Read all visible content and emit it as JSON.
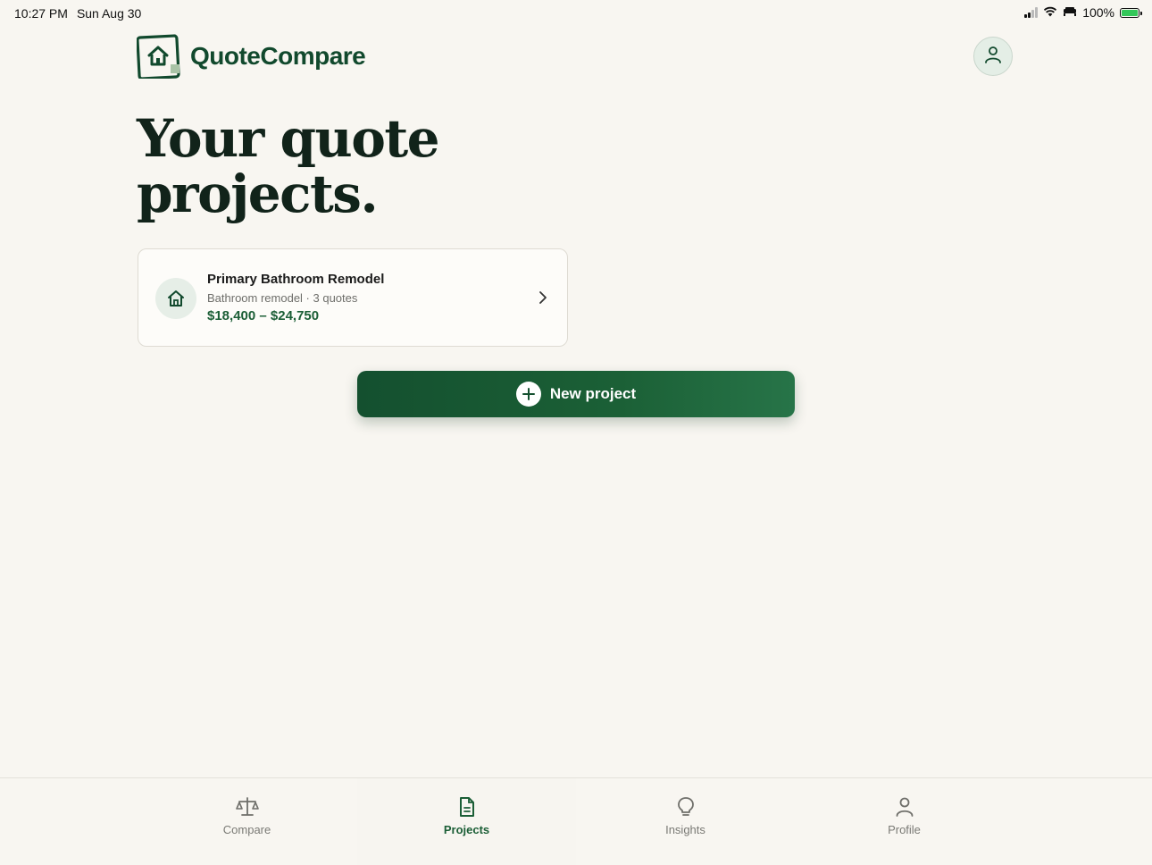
{
  "status_bar": {
    "time": "10:27 PM",
    "date": "Sun Aug 30",
    "battery": "100%"
  },
  "header": {
    "brand": "QuoteCompare",
    "account_icon": "user-icon"
  },
  "page": {
    "title": "Your quote projects."
  },
  "projects": [
    {
      "name": "Primary Bathroom Remodel",
      "meta": "Bathroom remodel · 3 quotes",
      "range": "$18,400 – $24,750",
      "icon": "house-icon"
    }
  ],
  "actions": {
    "new_project_label": "New project"
  },
  "tabs": [
    {
      "label": "Compare",
      "icon": "scale-icon",
      "active": false
    },
    {
      "label": "Projects",
      "icon": "document-icon",
      "active": true
    },
    {
      "label": "Insights",
      "icon": "lightbulb-icon",
      "active": false
    },
    {
      "label": "Profile",
      "icon": "person-icon",
      "active": false
    }
  ],
  "colors": {
    "brand_green": "#11492d",
    "accent_green": "#1b5e36",
    "background": "#f8f6f1"
  }
}
